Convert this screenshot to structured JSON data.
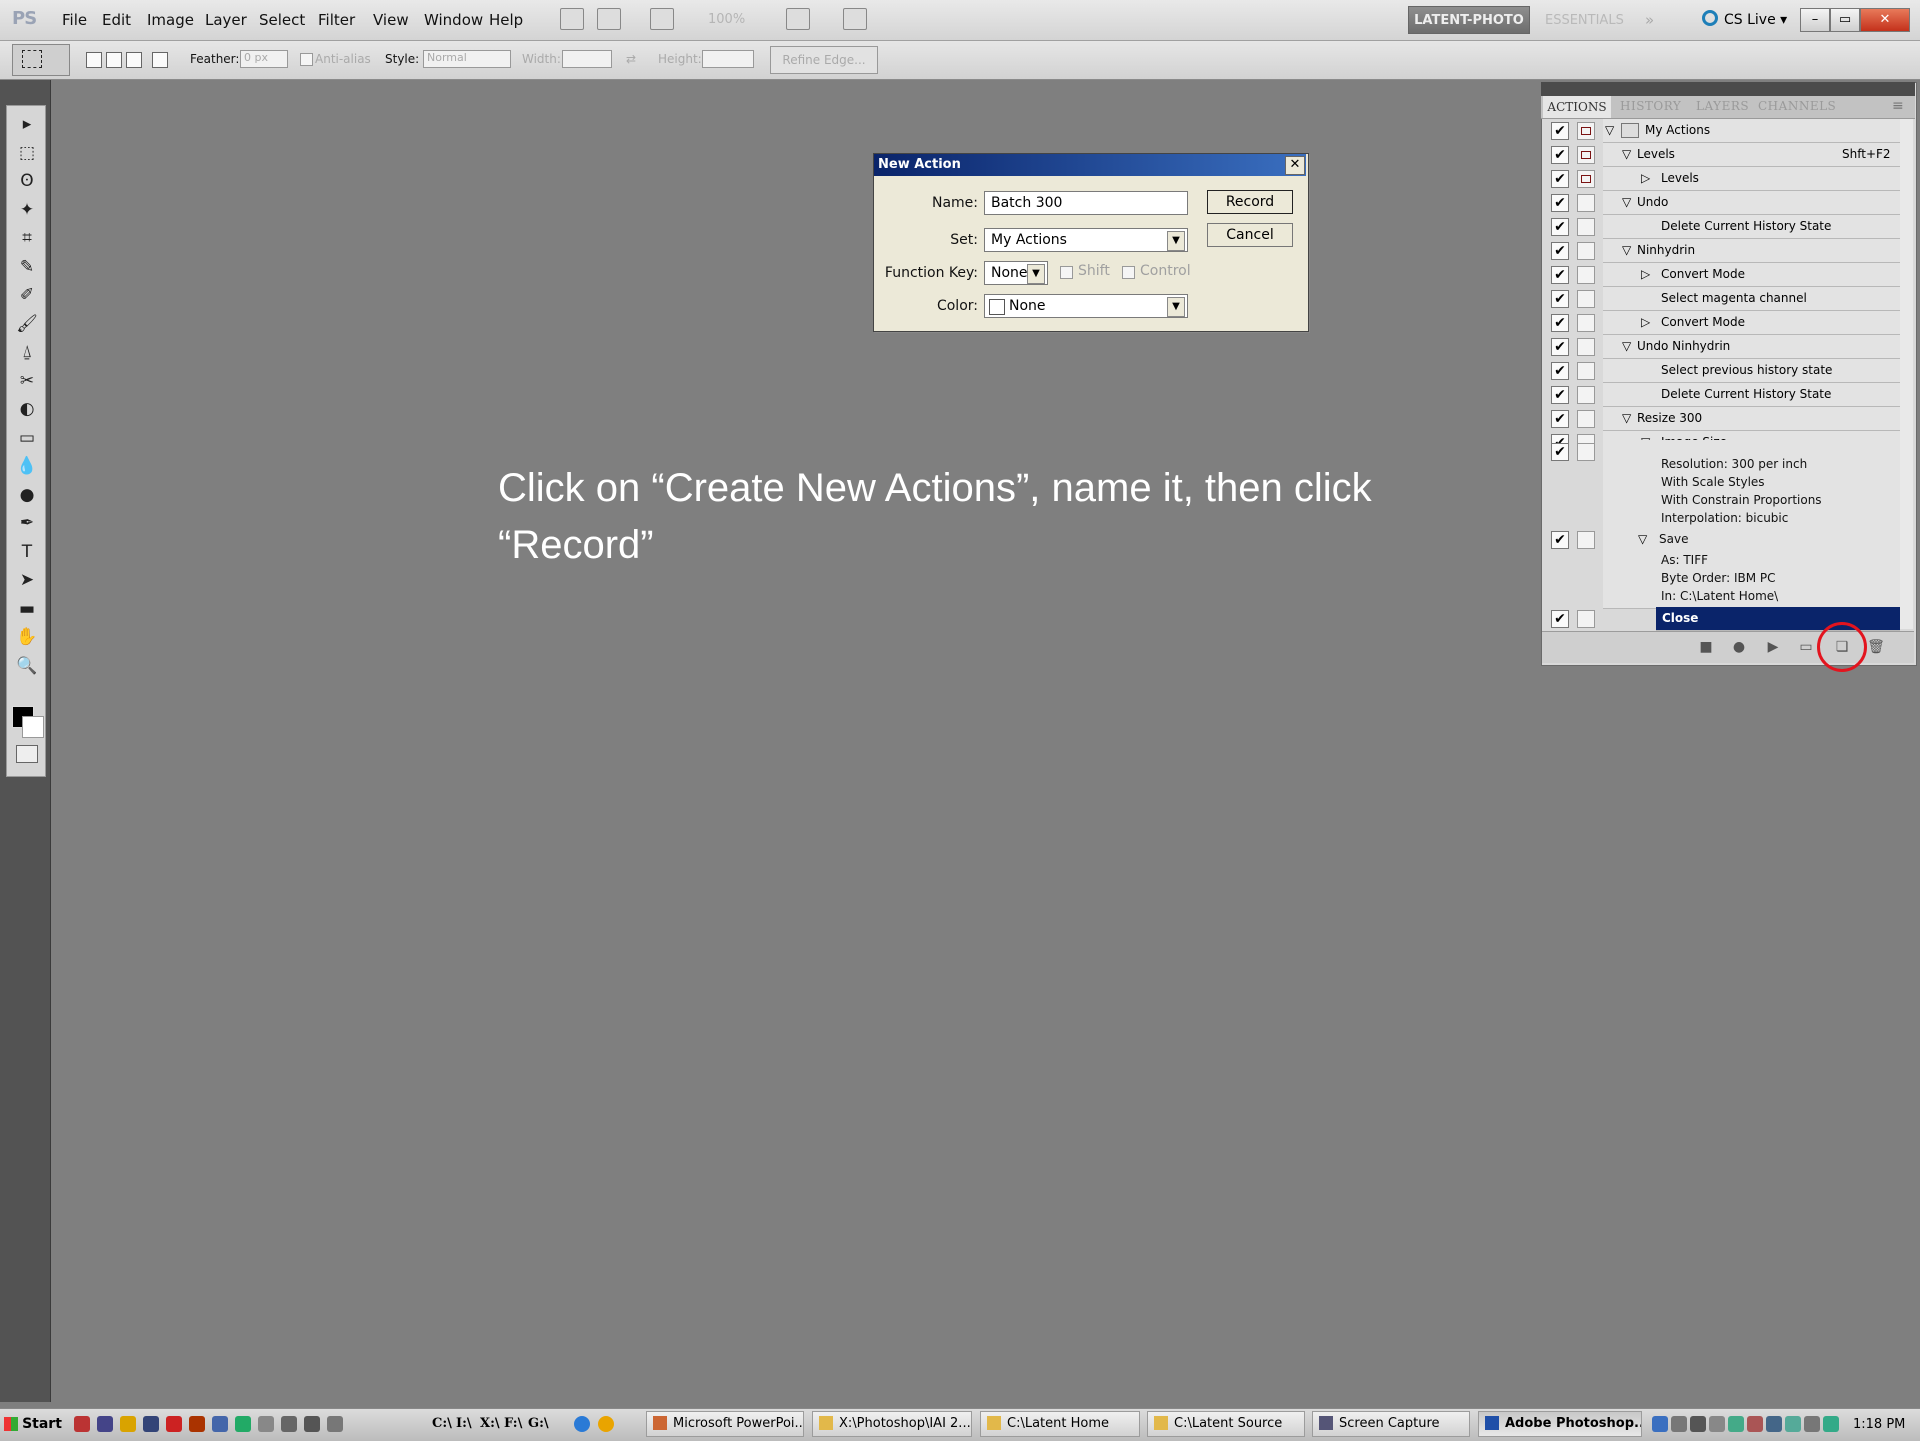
{
  "app": {
    "logo": "PS"
  },
  "menu": [
    "File",
    "Edit",
    "Image",
    "Layer",
    "Select",
    "Filter",
    "View",
    "Window",
    "Help"
  ],
  "zoom": "100%",
  "workspace": {
    "active": "LATENT-PHOTO",
    "other": "ESSENTIALS",
    "more": "»",
    "cslive": "CS Live ▾"
  },
  "window_buttons": {
    "minimize": "–",
    "restore": "▭",
    "close": "✕"
  },
  "options": {
    "feather_label": "Feather:",
    "feather_value": "0 px",
    "antialias": "Anti-alias",
    "style_label": "Style:",
    "style_value": "Normal",
    "width_label": "Width:",
    "height_label": "Height:",
    "refine": "Refine Edge..."
  },
  "tools": [
    "▸",
    "⬚",
    "ʘ",
    "✦",
    "⌗",
    "✎",
    "✐",
    "🖌",
    "⍙",
    "✂",
    "◐",
    "▭",
    "💧",
    "●",
    "✒",
    "T",
    "➤",
    "▬",
    "✋",
    "🔍"
  ],
  "panel": {
    "tabs": [
      "ACTIONS",
      "HISTORY",
      "LAYERS",
      "CHANNELS"
    ],
    "rows": [
      {
        "label": "My Actions",
        "indent": 0,
        "tri": "▽",
        "check": "✔",
        "dialog": true
      },
      {
        "label": "Levels",
        "indent": 1,
        "tri": "▽",
        "check": "✔",
        "dialog": true,
        "shortcut": "Shft+F2"
      },
      {
        "label": "Levels",
        "indent": 2,
        "tri": "▷",
        "check": "✔",
        "dialog": true
      },
      {
        "label": "Undo",
        "indent": 1,
        "tri": "▽",
        "check": "✔",
        "dialog": false
      },
      {
        "label": "Delete Current History State",
        "indent": 2,
        "tri": "",
        "check": "✔",
        "dialog": false
      },
      {
        "label": "Ninhydrin",
        "indent": 1,
        "tri": "▽",
        "check": "✔",
        "dialog": false
      },
      {
        "label": "Convert Mode",
        "indent": 2,
        "tri": "▷",
        "check": "✔",
        "dialog": false
      },
      {
        "label": "Select magenta channel",
        "indent": 2,
        "tri": "",
        "check": "✔",
        "dialog": false
      },
      {
        "label": "Convert Mode",
        "indent": 2,
        "tri": "▷",
        "check": "✔",
        "dialog": false
      },
      {
        "label": "Undo Ninhydrin",
        "indent": 1,
        "tri": "▽",
        "check": "✔",
        "dialog": false
      },
      {
        "label": "Select previous history state",
        "indent": 2,
        "tri": "",
        "check": "✔",
        "dialog": false
      },
      {
        "label": "Delete Current History State",
        "indent": 2,
        "tri": "",
        "check": "✔",
        "dialog": false
      },
      {
        "label": "Resize 300",
        "indent": 1,
        "tri": "▽",
        "check": "✔",
        "dialog": false
      },
      {
        "label": "Image Size",
        "indent": 2,
        "tri": "▽",
        "check": "✔",
        "dialog": false
      }
    ],
    "image_size_details": [
      "Resolution: 300 per inch",
      "With Scale Styles",
      "With Constrain Proportions",
      "Interpolation: bicubic"
    ],
    "save_label": "Save",
    "save_details": [
      "As: TIFF",
      "Byte Order: IBM PC",
      "In: C:\\Latent Home\\"
    ],
    "close_label": "Close",
    "check": "✔",
    "bottom_buttons": [
      "■",
      "●",
      "▶",
      "▭",
      "❏",
      "🗑"
    ]
  },
  "dialog": {
    "title": "New Action",
    "close": "✕",
    "name_label": "Name:",
    "name_value": "Batch 300",
    "set_label": "Set:",
    "set_value": "My Actions",
    "fkey_label": "Function Key:",
    "fkey_value": "None",
    "shift_label": "Shift",
    "control_label": "Control",
    "color_label": "Color:",
    "color_value": "None",
    "record": "Record",
    "cancel": "Cancel",
    "arrow": "▼"
  },
  "instruction": "Click on “Create New Actions”, name it, then click “Record”",
  "taskbar": {
    "start": "Start",
    "quick": [
      "C:\\",
      "I:\\",
      "X:\\",
      "F:\\",
      "G:\\"
    ],
    "buttons": [
      "Microsoft PowerPoi...",
      "X:\\Photoshop\\IAI 2...",
      "C:\\Latent Home",
      "C:\\Latent Source",
      "Screen Capture",
      "Adobe Photoshop..."
    ],
    "clock": "1:18 PM"
  }
}
